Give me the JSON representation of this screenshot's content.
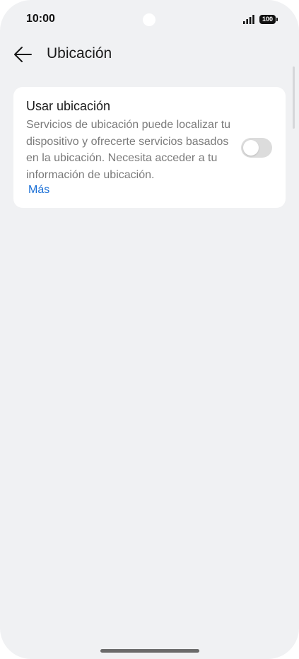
{
  "status_bar": {
    "time": "10:00",
    "battery": "100",
    "signal_icon": "signal-icon",
    "battery_icon": "battery-icon"
  },
  "header": {
    "back_icon": "arrow-left-icon",
    "title": "Ubicación"
  },
  "location_card": {
    "title": "Usar ubicación",
    "description": "Servicios de ubicación puede localizar tu dispositivo y ofrecerte servicios basados en la ubicación. Necesita acceder a tu información de ubicación.",
    "more_link": "Más",
    "toggle_on": false
  },
  "colors": {
    "background": "#f0f1f3",
    "card": "#ffffff",
    "link": "#1a6fd6",
    "toggle_off": "#dcdcdc"
  }
}
